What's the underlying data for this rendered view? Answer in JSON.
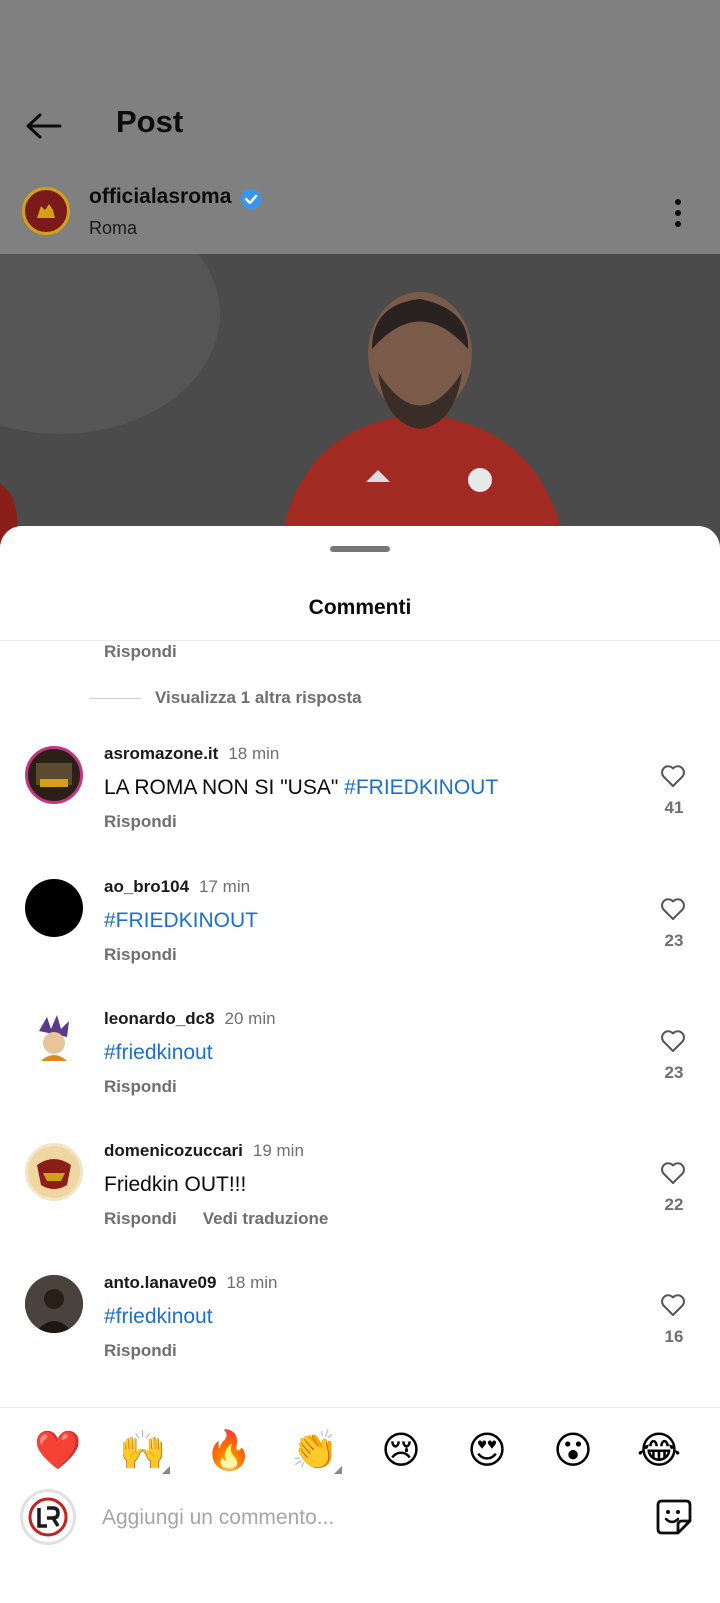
{
  "header": {
    "title": "Post"
  },
  "post": {
    "username": "officialasroma",
    "subtitle": "Roma"
  },
  "sheet": {
    "title": "Commenti",
    "top_reply_label": "Rispondi",
    "more_replies": "Visualizza 1 altra risposta"
  },
  "comments": [
    {
      "user": "asromazone.it",
      "time": "18 min",
      "text_plain": "LA ROMA NON SI \"USA\" ",
      "text_tag": "#FRIEDKINOUT",
      "reply": "Rispondi",
      "likes": "41"
    },
    {
      "user": "ao_bro104",
      "time": "17 min",
      "text_plain": "",
      "text_tag": "#FRIEDKINOUT",
      "reply": "Rispondi",
      "likes": "23"
    },
    {
      "user": "leonardo_dc8",
      "time": "20 min",
      "text_plain": "",
      "text_tag": "#friedkinout",
      "reply": "Rispondi",
      "likes": "23"
    },
    {
      "user": "domenicozuccari",
      "time": "19 min",
      "text_plain": "Friedkin OUT!!!",
      "text_tag": "",
      "reply": "Rispondi",
      "translate": "Vedi traduzione",
      "likes": "22"
    },
    {
      "user": "anto.lanave09",
      "time": "18 min",
      "text_plain": "",
      "text_tag": "#friedkinout",
      "reply": "Rispondi",
      "likes": "16"
    }
  ],
  "reactions": [
    "❤️",
    "🙌",
    "🔥",
    "👏",
    "😢",
    "😍",
    "😮",
    "😂"
  ],
  "composer": {
    "placeholder": "Aggiungi un commento..."
  },
  "colors": {
    "hashtag": "#1a6fd0",
    "verified": "#3797f0"
  }
}
